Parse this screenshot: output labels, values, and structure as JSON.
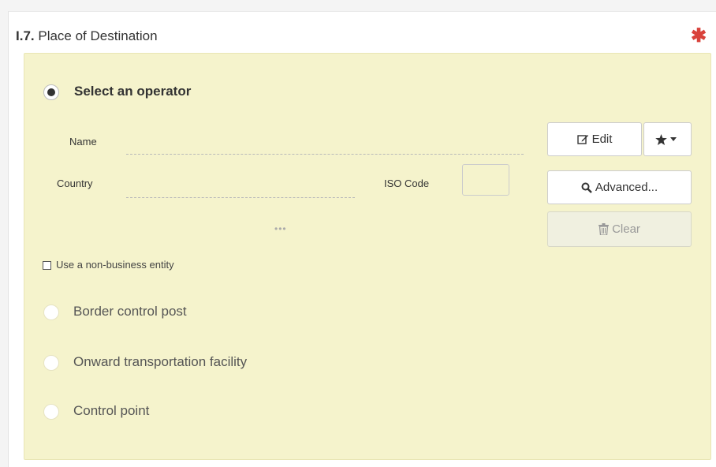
{
  "section": {
    "number": "I.7.",
    "title": "Place of Destination",
    "required_mark": "✱"
  },
  "options": {
    "select_operator": "Select an operator",
    "border_control_post": "Border control post",
    "onward_transportation_facility": "Onward transportation facility",
    "control_point": "Control point"
  },
  "fields": {
    "name_label": "Name",
    "name_value": "",
    "country_label": "Country",
    "country_value": "",
    "iso_code_label": "ISO Code",
    "iso_code_value": "",
    "more_indicator": "•••"
  },
  "buttons": {
    "edit": "Edit",
    "advanced": "Advanced...",
    "clear": "Clear"
  },
  "non_business": {
    "label": "Use a non-business entity",
    "checked": false
  },
  "colors": {
    "panel_background": "#f5f3cc",
    "required_red": "#d9423b"
  },
  "icons": {
    "edit": "edit-icon",
    "favorite": "star-icon",
    "dropdown": "caret-down-icon",
    "advanced": "search-icon",
    "clear": "trash-icon"
  }
}
